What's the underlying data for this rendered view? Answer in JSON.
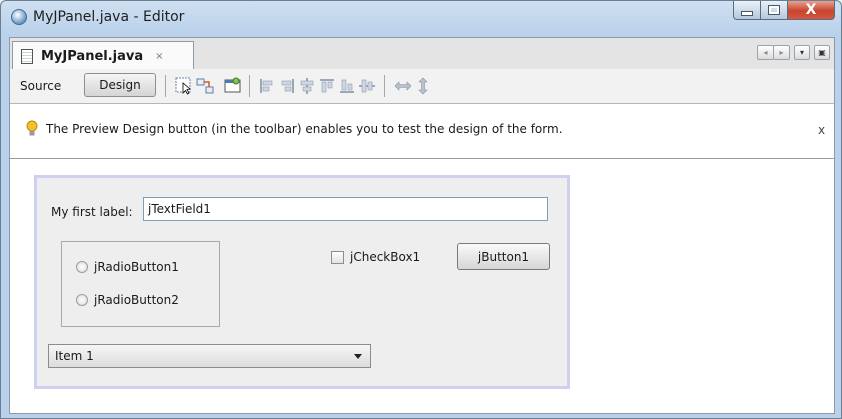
{
  "window": {
    "title": "MyJPanel.java - Editor",
    "controls": {
      "minimize": "minimize",
      "maximize": "maximize",
      "close": "X"
    }
  },
  "tabs": [
    {
      "label": "MyJPanel.java",
      "close": "×"
    }
  ],
  "tab_nav": {
    "left": "◂",
    "right": "▸",
    "dropdown": "▾",
    "restore": "▣"
  },
  "toolbar": {
    "source_label": "Source",
    "design_label": "Design",
    "icons": [
      "selection-mode-icon",
      "connection-mode-icon",
      "preview-design-icon",
      "align-left-icon",
      "align-right-icon",
      "center-horizontal-icon",
      "align-top-icon",
      "align-bottom-icon",
      "center-vertical-icon",
      "resize-horizontal-icon",
      "resize-vertical-icon"
    ]
  },
  "hint": {
    "text": "The Preview Design button (in the toolbar) enables you to test the design of the form.",
    "close": "x"
  },
  "form": {
    "label": "My first label:",
    "text_field": "jTextField1",
    "radio1": "jRadioButton1",
    "radio2": "jRadioButton2",
    "checkbox": "jCheckBox1",
    "button": "jButton1",
    "combo_selected": "Item 1"
  },
  "colors": {
    "titlebar": "#b9d1ea",
    "close_button": "#c9442e",
    "form_border": "#cfcff0",
    "hint_bulb": "#f3c22a"
  }
}
